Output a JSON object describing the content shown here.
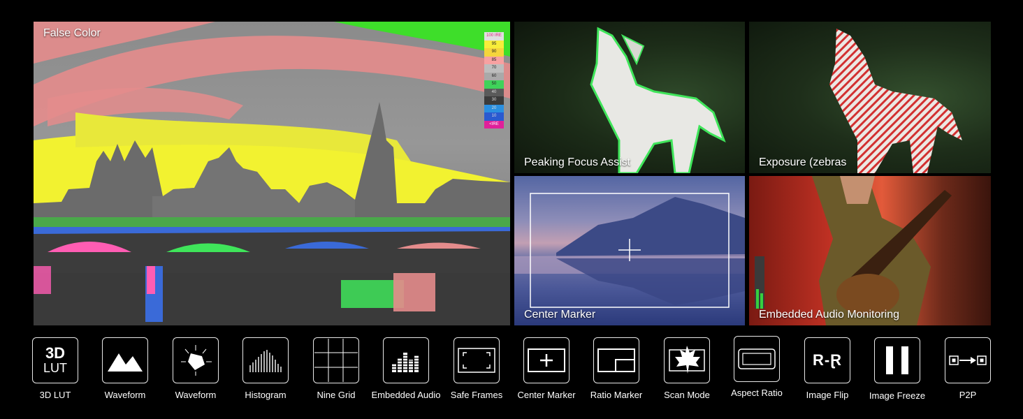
{
  "panels": {
    "false_color": "False Color",
    "peaking": "Peaking Focus Assist",
    "zebras": "Exposure (zebras",
    "center_marker": "Center Marker",
    "audio": "Embedded Audio Monitoring"
  },
  "false_color_scale": [
    "100 IRE",
    "95",
    "90",
    "85",
    "70",
    "60",
    "50",
    "40",
    "30",
    "20",
    "10",
    "<IRE"
  ],
  "icons": [
    {
      "label": "3D LUT",
      "glyph_top": "3D",
      "glyph_bottom": "LUT"
    },
    {
      "label": "Waveform"
    },
    {
      "label": "Waveform"
    },
    {
      "label": "Histogram"
    },
    {
      "label": "Nine Grid"
    },
    {
      "label": "Embedded Audio"
    },
    {
      "label": "Safe Frames"
    },
    {
      "label": "Center Marker"
    },
    {
      "label": "Ratio Marker"
    },
    {
      "label": "Scan Mode"
    },
    {
      "label": "Aspect Ratio"
    },
    {
      "label": "Image Flip",
      "glyph": "R-Ɽ"
    },
    {
      "label": "Image Freeze"
    },
    {
      "label": "P2P"
    }
  ]
}
